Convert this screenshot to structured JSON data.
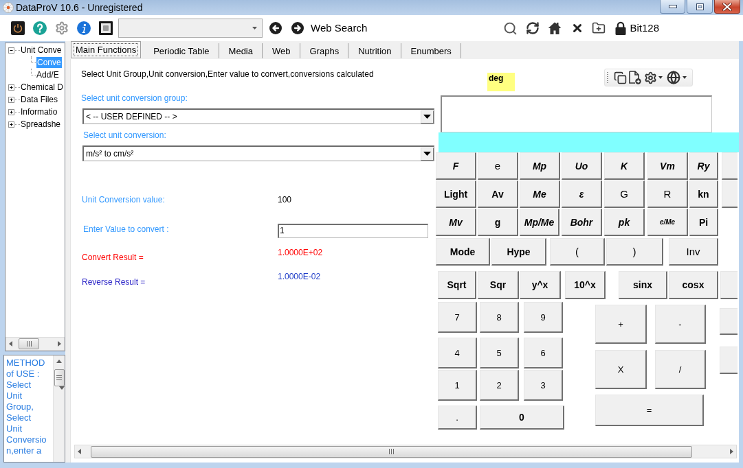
{
  "window": {
    "title": "DataProV 10.6 - Unregistered"
  },
  "toolbar": {
    "web_search": "Web Search",
    "security_level": "Bit128"
  },
  "tree": [
    {
      "label": "Unit Conve",
      "expanded": true,
      "selected": false,
      "children": [
        {
          "label": "Conve",
          "selected": true
        },
        {
          "label": "Add/E",
          "selected": false
        }
      ]
    },
    {
      "label": "Chemical D",
      "expanded": false,
      "selected": false
    },
    {
      "label": "Data Files",
      "expanded": false,
      "selected": false
    },
    {
      "label": "Informatio",
      "expanded": false,
      "selected": false
    },
    {
      "label": "Spreadshe",
      "expanded": false,
      "selected": false
    }
  ],
  "method_text": "METHOD of USE : Select Unit Group, Select Unit Conversion,enter a",
  "tabs": [
    {
      "label": "Main Functions",
      "selected": true
    },
    {
      "label": "Periodic Table",
      "selected": false
    },
    {
      "label": "Media",
      "selected": false
    },
    {
      "label": "Web",
      "selected": false
    },
    {
      "label": "Graphs",
      "selected": false
    },
    {
      "label": "Nutrition",
      "selected": false
    },
    {
      "label": "Enumbers",
      "selected": false
    }
  ],
  "form": {
    "instruction": "Select Unit Group,Unit conversion,Enter value to convert,conversions calculated",
    "group": {
      "label": "Select unit conversion group:",
      "value": "< -- USER DEFINED -- >"
    },
    "conversion": {
      "label": "Select unit conversion:",
      "value": "m/s² to cm/s²"
    },
    "fields": [
      {
        "kind": "readout",
        "label": "Unit Conversion value:",
        "value": "100"
      },
      {
        "kind": "entry",
        "label": "Enter Value to convert :",
        "value": "1"
      },
      {
        "kind": "forward",
        "label": "Convert Result =",
        "value": "1.0000E+02"
      },
      {
        "kind": "reverse",
        "label": "Reverse Result =",
        "value": "1.0000E-02"
      }
    ]
  },
  "calculator": {
    "angle_mode": "deg",
    "function_rows": [
      [
        {
          "label": "F",
          "kind": "italic"
        },
        {
          "label": "e",
          "kind": "plain"
        },
        {
          "label": "Mp",
          "kind": "italic"
        },
        {
          "label": "Uo",
          "kind": "italic"
        },
        {
          "label": "K",
          "kind": "italic"
        },
        {
          "label": "Vm",
          "kind": "italic"
        },
        {
          "label": "Ry",
          "kind": "italic"
        },
        {
          "kind": "clipped"
        }
      ],
      [
        {
          "label": "Light",
          "kind": "bold"
        },
        {
          "label": "Av",
          "kind": "bold"
        },
        {
          "label": "Me",
          "kind": "italic"
        },
        {
          "label": "ε",
          "kind": "italic"
        },
        {
          "label": "G",
          "kind": "plain"
        },
        {
          "label": "R",
          "kind": "plain"
        },
        {
          "label": "kn",
          "kind": "bold"
        },
        {
          "kind": "clipped"
        }
      ],
      [
        {
          "label": "Mv",
          "kind": "italic"
        },
        {
          "label": "g",
          "kind": "bold"
        },
        {
          "label": "Mp/Me",
          "kind": "italic"
        },
        {
          "label": "Bohr",
          "kind": "italic"
        },
        {
          "label": "pk",
          "kind": "italic"
        },
        {
          "label": "e/Me",
          "kind": "small"
        },
        {
          "label": "Pi",
          "kind": "bold"
        }
      ],
      [
        {
          "label": "Mode",
          "kind": "bold"
        },
        {
          "label": "Hype",
          "kind": "bold"
        },
        {
          "label": "(",
          "kind": "plain"
        },
        {
          "label": ")",
          "kind": "plain"
        },
        {
          "label": "Inv",
          "kind": "plain"
        }
      ],
      [
        {
          "label": "Sqrt",
          "kind": "bold"
        },
        {
          "label": "Sqr",
          "kind": "bold"
        },
        {
          "label": "y^x",
          "kind": "bold"
        },
        {
          "label": "10^x",
          "kind": "bold"
        },
        {
          "label": "sinx",
          "kind": "bold"
        },
        {
          "label": "cosx",
          "kind": "bold"
        },
        {
          "kind": "clipped"
        }
      ]
    ],
    "number_pad": [
      [
        {
          "label": "7",
          "kind": "plain"
        },
        {
          "label": "8",
          "kind": "plain"
        },
        {
          "label": "9",
          "kind": "plain"
        }
      ],
      [
        {
          "label": "4",
          "kind": "plain"
        },
        {
          "label": "5",
          "kind": "plain"
        },
        {
          "label": "6",
          "kind": "plain"
        }
      ],
      [
        {
          "label": "1",
          "kind": "plain"
        },
        {
          "label": "2",
          "kind": "plain"
        },
        {
          "label": "3",
          "kind": "plain"
        }
      ],
      [
        {
          "label": ".",
          "kind": "plain"
        },
        {
          "label": "0",
          "kind": "bold"
        }
      ]
    ],
    "operator_pad": [
      [
        {
          "label": "+",
          "kind": "plain"
        },
        {
          "label": "-",
          "kind": "plain"
        }
      ],
      [
        {
          "label": "X",
          "kind": "plain"
        },
        {
          "label": "/",
          "kind": "plain"
        }
      ],
      [
        {
          "label": "=",
          "kind": "plain"
        }
      ]
    ],
    "edge_keys": [
      {
        "kind": "clipped"
      },
      {
        "kind": "clipped"
      }
    ]
  }
}
